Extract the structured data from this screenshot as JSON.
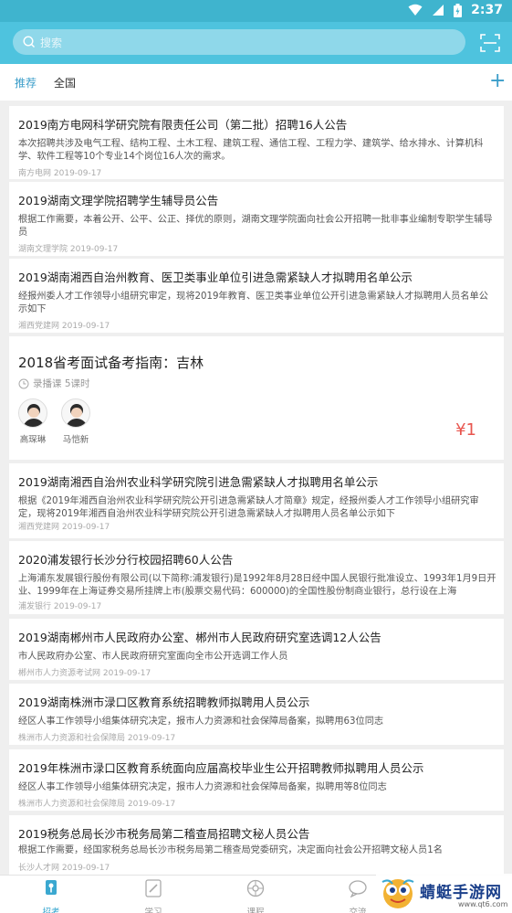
{
  "status_bar": {
    "time": "2:37"
  },
  "search": {
    "placeholder": "搜索"
  },
  "tabs": [
    {
      "label": "推荐",
      "active": true
    },
    {
      "label": "全国",
      "active": false
    }
  ],
  "add_label": "+",
  "articles": [
    {
      "title": "2019南方电网科学研究院有限责任公司（第二批）招聘16人公告",
      "desc": "本次招聘共涉及电气工程、结构工程、土木工程、建筑工程、通信工程、工程力学、建筑学、给水排水、计算机科学、软件工程等10个专业14个岗位16人次的需求。",
      "source": "南方电网",
      "date": "2019-09-17"
    },
    {
      "title": "2019湖南文理学院招聘学生辅导员公告",
      "desc": "根据工作需要，本着公开、公平、公正、择优的原则，湖南文理学院面向社会公开招聘一批非事业编制专职学生辅导员",
      "source": "湖南文理学院",
      "date": "2019-09-17"
    },
    {
      "title": "2019湖南湘西自治州教育、医卫类事业单位引进急需紧缺人才拟聘用名单公示",
      "desc": "经报州委人才工作领导小组研究审定，现将2019年教育、医卫类事业单位公开引进急需紧缺人才拟聘用人员名单公示如下",
      "source": "湘西党建网",
      "date": "2019-09-17"
    }
  ],
  "course": {
    "title": "2018省考面试备考指南：吉林",
    "type": "录播课 5课时",
    "teachers": [
      "高琛琳",
      "马恺新"
    ],
    "price": "¥1"
  },
  "articles2": [
    {
      "title": "2019湖南湘西自治州农业科学研究院引进急需紧缺人才拟聘用名单公示",
      "desc": "根据《2019年湘西自治州农业科学研究院公开引进急需紧缺人才简章》规定，经报州委人才工作领导小组研究审定，现将2019年湘西自治州农业科学研究院公开引进急需紧缺人才拟聘用人员名单公示如下",
      "source": "湘西党建网",
      "date": "2019-09-17"
    },
    {
      "title": "2020浦发银行长沙分行校园招聘60人公告",
      "desc": "上海浦东发展银行股份有限公司(以下简称:浦发银行)是1992年8月28日经中国人民银行批准设立、1993年1月9日开业、1999年在上海证券交易所挂牌上市(股票交易代码：600000)的全国性股份制商业银行，总行设在上海",
      "source": "浦发银行",
      "date": "2019-09-17"
    },
    {
      "title": "2019湖南郴州市人民政府办公室、郴州市人民政府研究室选调12人公告",
      "desc": "市人民政府办公室、市人民政府研究室面向全市公开选调工作人员",
      "source": "郴州市人力资源考试网",
      "date": "2019-09-17"
    },
    {
      "title": "2019湖南株洲市渌口区教育系统招聘教师拟聘用人员公示",
      "desc": "经区人事工作领导小组集体研究决定，报市人力资源和社会保障局备案，拟聘用63位同志",
      "source": "株洲市人力资源和社会保障局",
      "date": "2019-09-17"
    },
    {
      "title": "2019年株洲市渌口区教育系统面向应届高校毕业生公开招聘教师拟聘用人员公示",
      "desc": "经区人事工作领导小组集体研究决定，报市人力资源和社会保障局备案，拟聘用等8位同志",
      "source": "株洲市人力资源和社会保障局",
      "date": "2019-09-17"
    },
    {
      "title": "2019税务总局长沙市税务局第二稽查局招聘文秘人员公告",
      "desc": "根据工作需要，经国家税务总局长沙市税务局第二稽查局党委研究，决定面向社会公开招聘文秘人员1名",
      "source": "长沙人才网",
      "date": "2019-09-17"
    }
  ],
  "nav": [
    {
      "label": "招考",
      "icon": "key-icon",
      "active": true
    },
    {
      "label": "学习",
      "icon": "pencil-icon",
      "active": false
    },
    {
      "label": "课程",
      "icon": "course-icon",
      "active": false
    },
    {
      "label": "交流",
      "icon": "chat-icon",
      "active": false
    }
  ],
  "watermark": {
    "text": "蜻蜓手游网",
    "sub": "www.qt6.com"
  },
  "colors": {
    "header": "#4ec3de",
    "accent": "#3a9dc9",
    "price": "#e8554e"
  }
}
